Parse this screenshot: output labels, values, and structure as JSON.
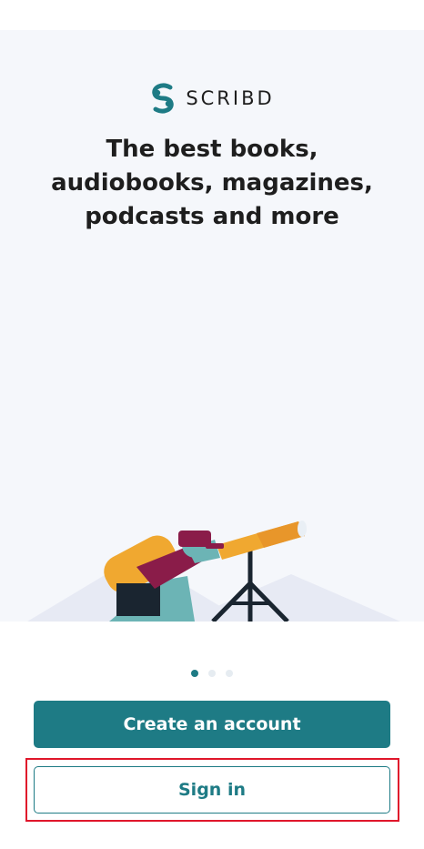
{
  "brand": {
    "name": "SCRIBD",
    "accent": "#1e7b85"
  },
  "onboarding": {
    "headline": "The best books, audiobooks, magazines, podcasts and more",
    "pager": {
      "current": 1,
      "total": 3
    }
  },
  "actions": {
    "create_account_label": "Create an account",
    "sign_in_label": "Sign in"
  }
}
